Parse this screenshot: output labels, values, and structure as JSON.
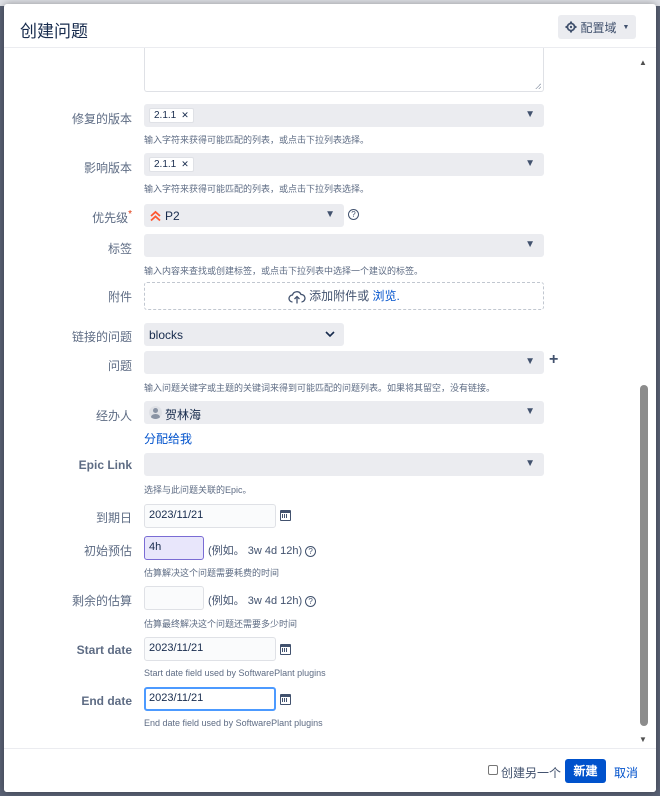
{
  "dialog": {
    "title": "创建问题",
    "config_label": "配置域"
  },
  "fields": {
    "fix_version": {
      "label": "修复的版本",
      "tag": "2.1.1",
      "hint": "输入字符来获得可能匹配的列表，或点击下拉列表选择。"
    },
    "affects_version": {
      "label": "影响版本",
      "tag": "2.1.1",
      "hint": "输入字符来获得可能匹配的列表，或点击下拉列表选择。"
    },
    "priority": {
      "label": "优先级",
      "required_mark": "*",
      "value": "P2",
      "help": "?"
    },
    "labels": {
      "label": "标签",
      "hint": "输入内容来查找或创建标签，或点击下拉列表中选择一个建议的标签。"
    },
    "attachment": {
      "label": "附件",
      "text": "添加附件或",
      "browse": "浏览."
    },
    "linked_issues": {
      "label": "链接的问题",
      "value": "blocks"
    },
    "issue": {
      "label": "问题",
      "hint": "输入问题关键字或主题的关键词来得到可能匹配的问题列表。如果将其留空，没有链接。"
    },
    "assignee": {
      "label": "经办人",
      "value": "贺林海",
      "assign_me": "分配给我"
    },
    "epic_link": {
      "label": "Epic Link",
      "hint": "选择与此问题关联的Epic。"
    },
    "due_date": {
      "label": "到期日",
      "value": "2023/11/21"
    },
    "original_estimate": {
      "label": "初始预估",
      "value": "4h",
      "example": "(例如。 3w 4d 12h)",
      "hint": "估算解决这个问题需要耗费的时间"
    },
    "remaining_estimate": {
      "label": "剩余的估算",
      "value": "",
      "example": "(例如。 3w 4d 12h)",
      "hint": "估算最终解决这个问题还需要多少时间"
    },
    "start_date": {
      "label": "Start date",
      "value": "2023/11/21",
      "hint": "Start date field used by SoftwarePlant plugins"
    },
    "end_date": {
      "label": "End date",
      "value": "2023/11/21",
      "hint": "End date field used by SoftwarePlant plugins"
    }
  },
  "footer": {
    "create_another": "创建另一个",
    "create": "新建",
    "cancel": "取消"
  },
  "colors": {
    "primary": "#0052cc",
    "priority_icon": "#ff5630",
    "required": "#de350b"
  }
}
